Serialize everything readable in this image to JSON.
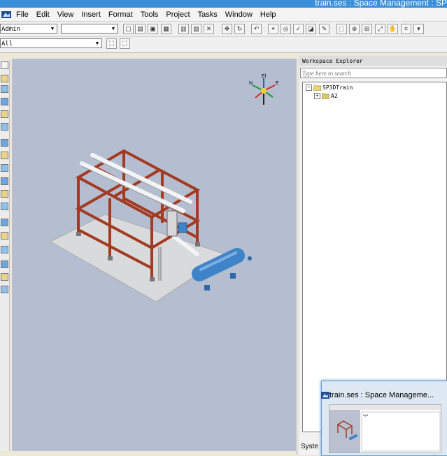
{
  "window": {
    "title": "train.ses : Space Management : SP"
  },
  "menubar": {
    "items": [
      "File",
      "Edit",
      "View",
      "Insert",
      "Format",
      "Tools",
      "Project",
      "Tasks",
      "Window",
      "Help"
    ]
  },
  "toolbar": {
    "permission_group": "Admin",
    "active_layer": "",
    "filter_value": "All",
    "icons": [
      "new-file-icon",
      "open-file-icon",
      "save-icon",
      "properties-icon",
      "copy-icon",
      "paste-icon",
      "delete-icon",
      "move-icon",
      "rotate-icon",
      "undo-icon",
      "coordinate-icon",
      "refresh-icon",
      "check-icon",
      "measure-icon",
      "edit-icon",
      "view-cube-icon",
      "zoom-icon",
      "zoom-area-icon",
      "fit-icon",
      "pan-icon",
      "clip-icon",
      "more-icon"
    ]
  },
  "compass": {
    "up": "El",
    "north": "N",
    "east": "E"
  },
  "workspace_explorer": {
    "title": "Workspace Explorer",
    "search_placeholder": "Type here to search",
    "tree": [
      {
        "label": "SP3DTrain",
        "expanded": true,
        "children": [
          {
            "label": "A2",
            "expanded": false
          }
        ]
      }
    ],
    "bottom_tab": "Syste"
  },
  "taskbar_preview": {
    "title": "train.ses : Space Manageme...",
    "thumb_caption": "Sp3"
  },
  "colors": {
    "steel": "#a33a22",
    "vessel": "#3f83c9",
    "pipe": "#e9ecef",
    "viewport_bg": "#b5bed0",
    "slab": "#d9dadb"
  }
}
